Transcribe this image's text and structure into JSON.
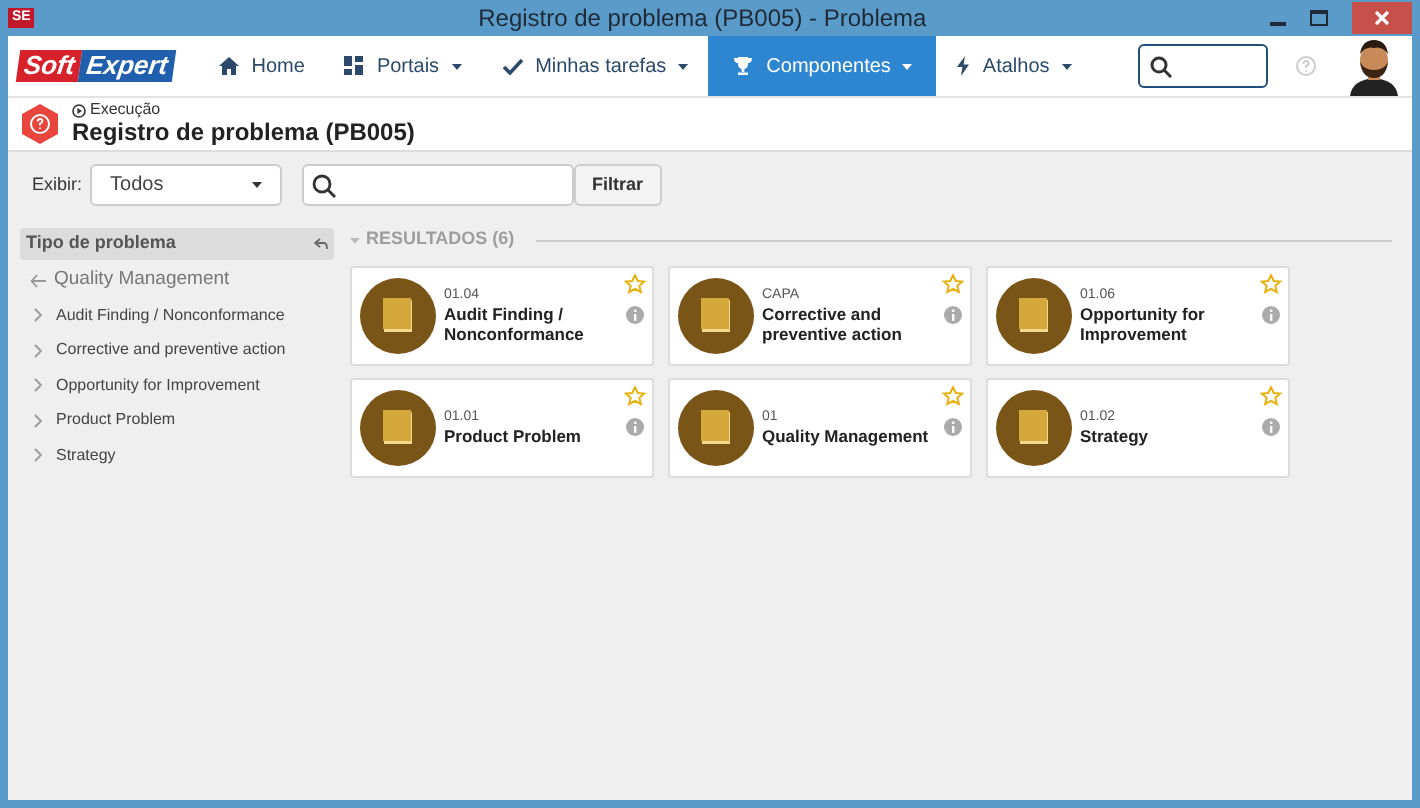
{
  "window": {
    "title": "Registro de problema (PB005) - Problema",
    "app_icon": "SE"
  },
  "logo": {
    "part_1": "Soft",
    "part_2": "Expert"
  },
  "nav": [
    {
      "label": "Home",
      "kind": "home",
      "dropdown": false,
      "selected": false
    },
    {
      "label": "Portais",
      "kind": "grid",
      "dropdown": true,
      "selected": false
    },
    {
      "label": "Minhas tarefas",
      "kind": "check",
      "dropdown": true,
      "selected": false
    },
    {
      "label": "Componentes",
      "kind": "trophy",
      "dropdown": true,
      "selected": true
    },
    {
      "label": "Atalhos",
      "kind": "bolt",
      "dropdown": true,
      "selected": false
    }
  ],
  "header": {
    "breadcrumb": "Execução",
    "title": "Registro de problema (PB005)"
  },
  "filter": {
    "label": "Exibir:",
    "select_value": "Todos",
    "button": "Filtrar"
  },
  "sidebar": {
    "title": "Tipo de problema",
    "parent": "Quality Management",
    "items": [
      "Audit Finding / Nonconformance",
      "Corrective and preventive action",
      "Opportunity for Improvement",
      "Product Problem",
      "Strategy"
    ]
  },
  "results": {
    "heading": "RESULTADOS (6)",
    "cards": [
      {
        "code": "01.04",
        "name": "Audit Finding / Nonconformance"
      },
      {
        "code": "CAPA",
        "name": "Corrective and preventive action"
      },
      {
        "code": "01.06",
        "name": "Opportunity for Improvement"
      },
      {
        "code": "01.01",
        "name": "Product Problem"
      },
      {
        "code": "01",
        "name": "Quality Management"
      },
      {
        "code": "01.02",
        "name": "Strategy"
      }
    ]
  }
}
